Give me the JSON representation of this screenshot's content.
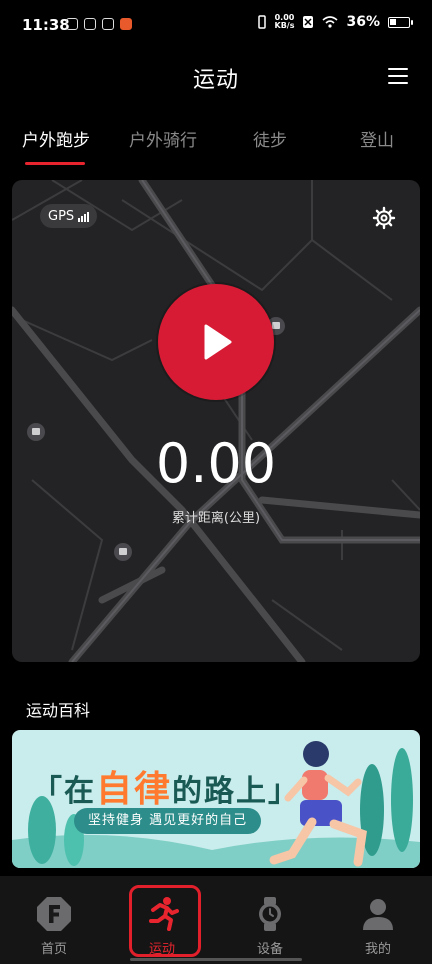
{
  "status_bar": {
    "time": "11:38",
    "net_speed_value": "0.00",
    "net_speed_unit": "KB/s",
    "battery_percent": "36%",
    "battery_level": 0.36
  },
  "header": {
    "title": "运动",
    "menu_icon": "menu-icon"
  },
  "tabs": [
    {
      "label": "户外跑步",
      "active": true
    },
    {
      "label": "户外骑行",
      "active": false
    },
    {
      "label": "徒步",
      "active": false
    },
    {
      "label": "登山",
      "active": false
    }
  ],
  "map": {
    "gps_label": "GPS",
    "distance_value": "0.00",
    "distance_label": "累计距离(公里)",
    "start_icon": "play-icon",
    "settings_icon": "gear-icon"
  },
  "encyclopedia": {
    "title": "运动百科",
    "banner_headline_1": "「在",
    "banner_headline_hl": "自律",
    "banner_headline_2": "的路上」",
    "banner_subtitle": "坚持健身 遇见更好的自己"
  },
  "bottom_nav": [
    {
      "label": "首页",
      "icon": "home-f-icon",
      "active": false
    },
    {
      "label": "运动",
      "icon": "runner-icon",
      "active": true
    },
    {
      "label": "设备",
      "icon": "watch-icon",
      "active": false
    },
    {
      "label": "我的",
      "icon": "profile-icon",
      "active": false
    }
  ],
  "colors": {
    "accent": "#e8252f",
    "play_button": "#d71b34",
    "map_background": "#232325",
    "banner_background": "#c9ecec"
  }
}
